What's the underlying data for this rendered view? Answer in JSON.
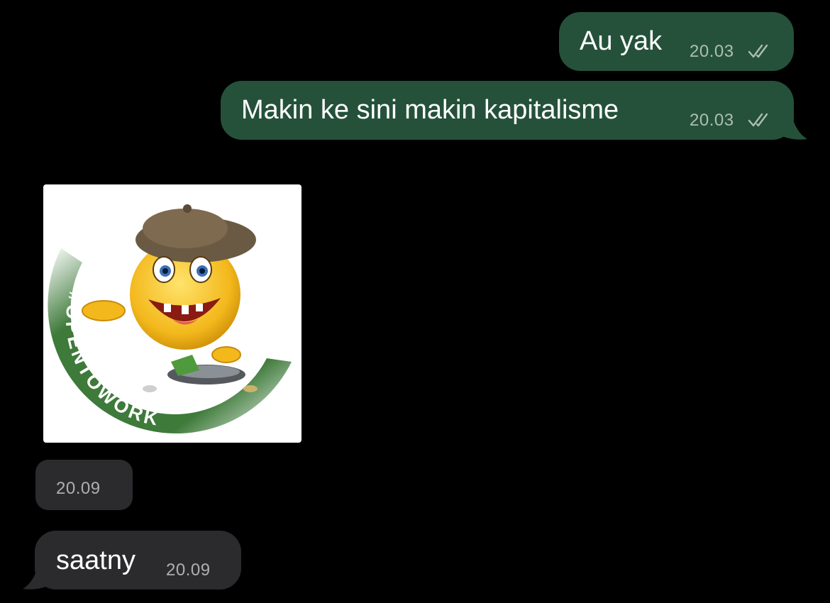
{
  "chat": {
    "messages": [
      {
        "direction": "outgoing",
        "text": "Au yak",
        "time": "20.03",
        "status": "read-double-check-icon"
      },
      {
        "direction": "outgoing",
        "text": "Makin ke sini makin kapitalisme",
        "time": "20.03",
        "status": "read-double-check-icon"
      },
      {
        "direction": "incoming",
        "type": "sticker",
        "sticker_text": "#OPENTOWORK",
        "time": "20.09"
      },
      {
        "direction": "incoming",
        "text": "saatny",
        "time": "20.09"
      }
    ]
  },
  "colors": {
    "background": "#000000",
    "outgoing_bubble": "#25513a",
    "incoming_bubble": "#2b2b2d",
    "sticker_ring": "#3e7a3a"
  }
}
